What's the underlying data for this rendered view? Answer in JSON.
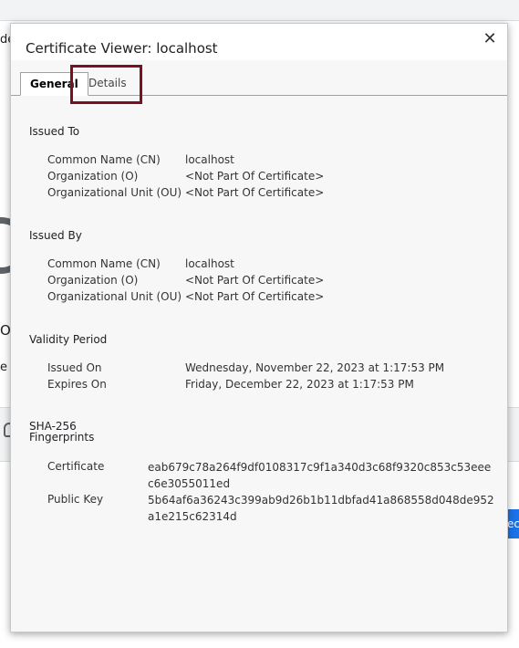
{
  "background": {
    "partial_text_left_top": "de",
    "partial_text_o": "O",
    "partial_text_e": "e",
    "blue_button_partial": "ect"
  },
  "dialog": {
    "title": "Certificate Viewer: localhost",
    "close_glyph": "✕",
    "tabs": [
      {
        "label": "General",
        "active": true
      },
      {
        "label": "Details",
        "active": false
      }
    ],
    "issued_to": {
      "heading": "Issued To",
      "rows": [
        {
          "label": "Common Name (CN)",
          "value": "localhost"
        },
        {
          "label": "Organization (O)",
          "value": "<Not Part Of Certificate>"
        },
        {
          "label": "Organizational Unit (OU)",
          "value": "<Not Part Of Certificate>"
        }
      ]
    },
    "issued_by": {
      "heading": "Issued By",
      "rows": [
        {
          "label": "Common Name (CN)",
          "value": "localhost"
        },
        {
          "label": "Organization (O)",
          "value": "<Not Part Of Certificate>"
        },
        {
          "label": "Organizational Unit (OU)",
          "value": "<Not Part Of Certificate>"
        }
      ]
    },
    "validity": {
      "heading": "Validity Period",
      "rows": [
        {
          "label": "Issued On",
          "value": "Wednesday, November 22, 2023 at 1:17:53 PM"
        },
        {
          "label": "Expires On",
          "value": "Friday, December 22, 2023 at 1:17:53 PM"
        }
      ]
    },
    "fingerprints": {
      "heading_line1": "SHA-256",
      "heading_line2": "Fingerprints",
      "rows": [
        {
          "label": "Certificate",
          "value": "eab679c78a264f9df0108317c9f1a340d3c68f9320c853c53eeec6e3055011ed"
        },
        {
          "label": "Public Key",
          "value": "5b64af6a36243c399ab9d26b1b11dbfad41a868558d048de952a1e215c62314d"
        }
      ]
    }
  },
  "colors": {
    "highlight_box": "#7b1020",
    "blue_button": "#1a73e8"
  }
}
